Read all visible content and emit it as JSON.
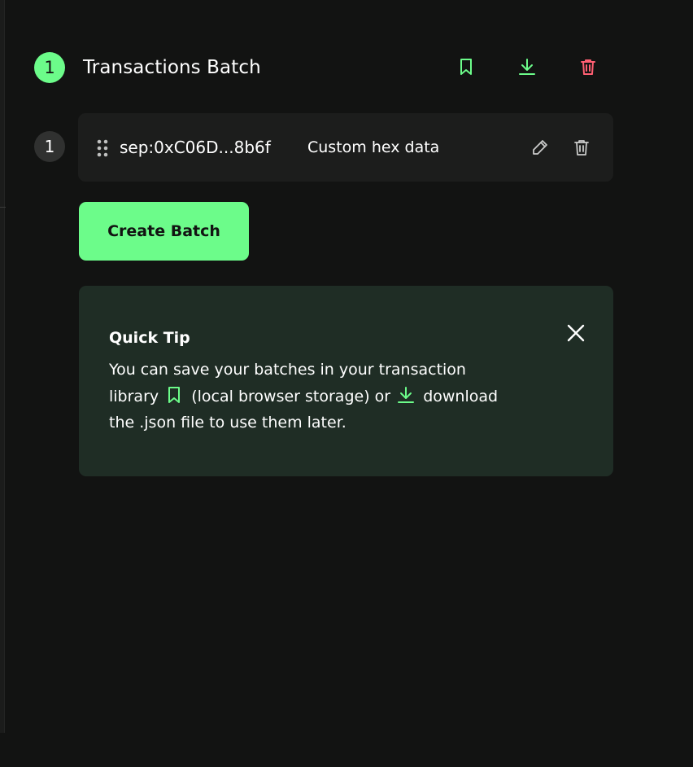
{
  "colors": {
    "background": "#121312",
    "accent_green": "#6cfc8a",
    "danger_red": "#ff5f72",
    "card_bg": "#1c1d1c",
    "tip_bg": "#1f2d25",
    "muted_icon": "#c9cac9"
  },
  "header": {
    "count": "1",
    "title": "Transactions Batch",
    "icons": [
      "bookmark-icon",
      "download-icon",
      "trash-icon"
    ]
  },
  "transactions": [
    {
      "index": "1",
      "address": "sep:0xC06D...8b6f",
      "method": "Custom hex data",
      "icons": [
        "drag-handle-icon",
        "pencil-icon",
        "trash-icon"
      ]
    }
  ],
  "create_batch": {
    "label": "Create Batch"
  },
  "tip": {
    "title": "Quick Tip",
    "line1": "You can save your batches in your transaction",
    "line2_part1": "library",
    "line2_part2": "(local browser storage) or",
    "line2_part3": "download",
    "line3": "the .json file to use them later.",
    "icons": [
      "bookmark-icon",
      "download-icon",
      "close-icon"
    ]
  }
}
